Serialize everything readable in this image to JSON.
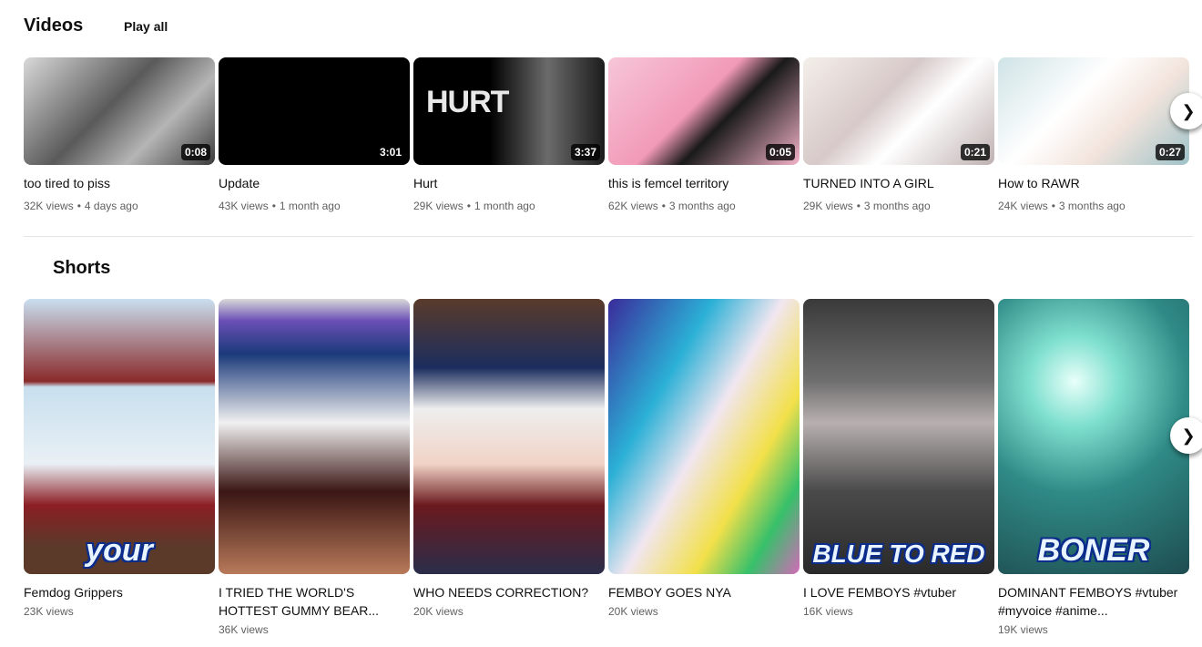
{
  "videos": {
    "title": "Videos",
    "play_all": "Play all",
    "next_icon": "chevron-right-icon",
    "items": [
      {
        "title": "too tired to piss",
        "views": "32K views",
        "age": "4 days ago",
        "duration": "0:08"
      },
      {
        "title": "Update",
        "views": "43K views",
        "age": "1 month ago",
        "duration": "3:01"
      },
      {
        "title": "Hurt",
        "views": "29K views",
        "age": "1 month ago",
        "duration": "3:37",
        "overlay": "HURT"
      },
      {
        "title": "this is femcel territory",
        "views": "62K views",
        "age": "3 months ago",
        "duration": "0:05"
      },
      {
        "title": "TURNED INTO A GIRL",
        "views": "29K views",
        "age": "3 months ago",
        "duration": "0:21"
      },
      {
        "title": "How to RAWR",
        "views": "24K views",
        "age": "3 months ago",
        "duration": "0:27"
      }
    ]
  },
  "shorts": {
    "title": "Shorts",
    "next_icon": "chevron-right-icon",
    "items": [
      {
        "title": "Femdog Grippers",
        "views": "23K views",
        "caption": "your"
      },
      {
        "title": "I TRIED THE WORLD'S HOTTEST GUMMY BEAR...",
        "views": "36K views",
        "caption": ""
      },
      {
        "title": "WHO NEEDS CORRECTION?",
        "views": "20K views",
        "caption": ""
      },
      {
        "title": "FEMBOY GOES NYA",
        "views": "20K views",
        "caption": ""
      },
      {
        "title": "I LOVE FEMBOYS #vtuber",
        "views": "16K views",
        "caption": "BLUE TO RED"
      },
      {
        "title": "DOMINANT FEMBOYS #vtuber #myvoice #anime...",
        "views": "19K views",
        "caption": "BONER"
      }
    ]
  },
  "colors": {
    "meta_text": "#606060",
    "divider": "#e5e5e5",
    "duration_bg": "#000000"
  }
}
